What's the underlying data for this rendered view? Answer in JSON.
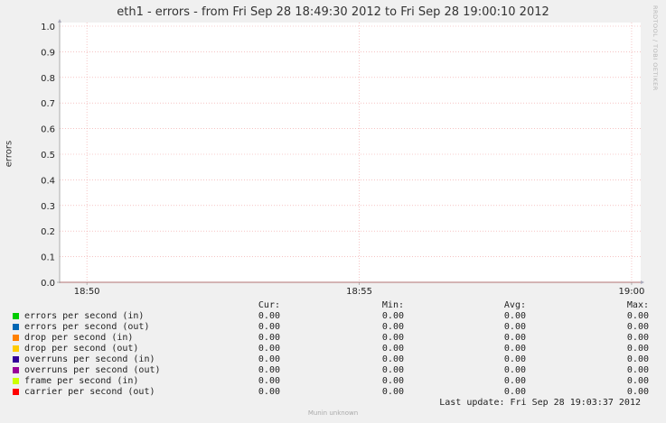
{
  "chart_data": {
    "type": "line",
    "title": "eth1 - errors - from Fri Sep 28 18:49:30 2012 to Fri Sep 28 19:00:10 2012",
    "ylabel": "errors",
    "ylim": [
      0,
      1.0
    ],
    "yticks": [
      "0.0",
      "0.1",
      "0.2",
      "0.3",
      "0.4",
      "0.5",
      "0.6",
      "0.7",
      "0.8",
      "0.9",
      "1.0"
    ],
    "xlim": [
      "18:49:30",
      "19:00:10"
    ],
    "xticks": [
      "18:50",
      "18:55",
      "19:00"
    ],
    "grid": true,
    "series": [
      {
        "name": "errors per second (in)",
        "color": "#00cc00",
        "values": [
          0,
          0
        ]
      },
      {
        "name": "errors per second (out)",
        "color": "#0066b3",
        "values": [
          0,
          0
        ]
      },
      {
        "name": "drop per second (in)",
        "color": "#ff8000",
        "values": [
          0,
          0
        ]
      },
      {
        "name": "drop per second (out)",
        "color": "#ffcc00",
        "values": [
          0,
          0
        ]
      },
      {
        "name": "overruns per second (in)",
        "color": "#330099",
        "values": [
          0,
          0
        ]
      },
      {
        "name": "overruns per second (out)",
        "color": "#990099",
        "values": [
          0,
          0
        ]
      },
      {
        "name": "frame per second (in)",
        "color": "#ccff00",
        "values": [
          0,
          0
        ]
      },
      {
        "name": "carrier per second (out)",
        "color": "#ff0000",
        "values": [
          0,
          0
        ]
      }
    ]
  },
  "vendor": "RRDTOOL / TOBI OETIKER",
  "legend_headers": {
    "cur": "Cur:",
    "min": "Min:",
    "avg": "Avg:",
    "max": "Max:"
  },
  "legend_rows": [
    {
      "label": "errors per second (in)",
      "cur": "0.00",
      "min": "0.00",
      "avg": "0.00",
      "max": "0.00"
    },
    {
      "label": "errors per second (out)",
      "cur": "0.00",
      "min": "0.00",
      "avg": "0.00",
      "max": "0.00"
    },
    {
      "label": "drop per second (in)",
      "cur": "0.00",
      "min": "0.00",
      "avg": "0.00",
      "max": "0.00"
    },
    {
      "label": "drop per second (out)",
      "cur": "0.00",
      "min": "0.00",
      "avg": "0.00",
      "max": "0.00"
    },
    {
      "label": "overruns per second (in)",
      "cur": "0.00",
      "min": "0.00",
      "avg": "0.00",
      "max": "0.00"
    },
    {
      "label": "overruns per second (out)",
      "cur": "0.00",
      "min": "0.00",
      "avg": "0.00",
      "max": "0.00"
    },
    {
      "label": "frame per second (in)",
      "cur": "0.00",
      "min": "0.00",
      "avg": "0.00",
      "max": "0.00"
    },
    {
      "label": "carrier per second (out)",
      "cur": "0.00",
      "min": "0.00",
      "avg": "0.00",
      "max": "0.00"
    }
  ],
  "last_update": "Last update: Fri Sep 28 19:03:37 2012",
  "footer": "Munin unknown"
}
